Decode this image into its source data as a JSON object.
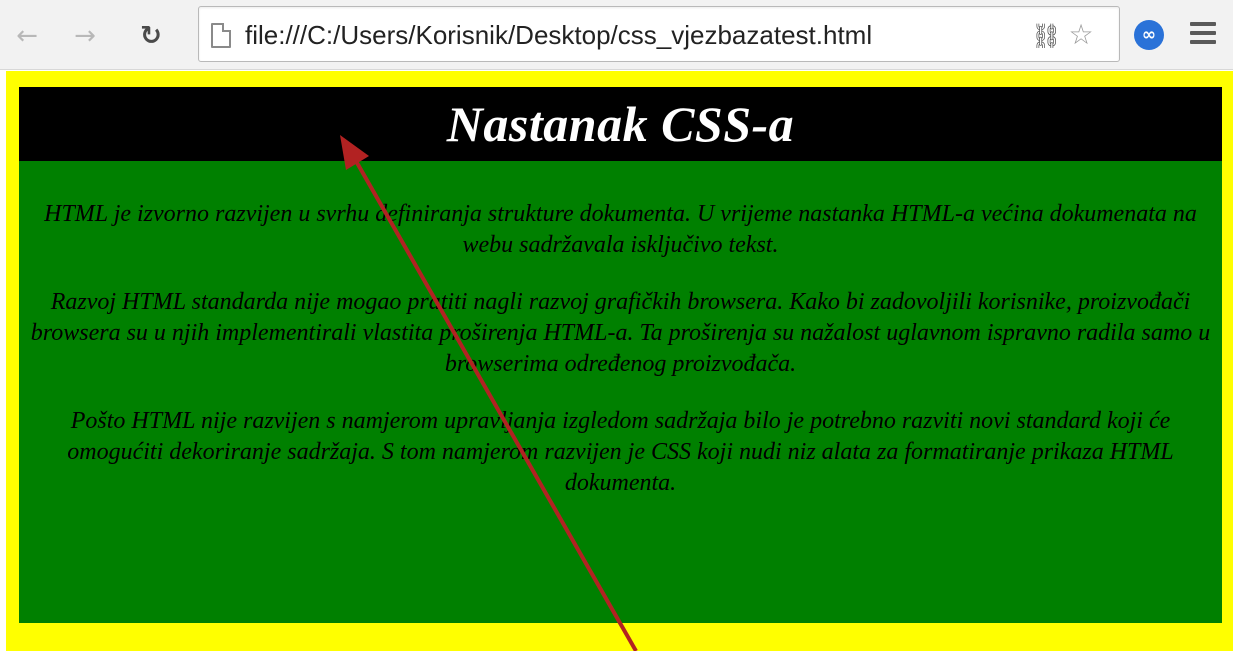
{
  "browser": {
    "nav": {
      "back_icon": "arrow-left-icon",
      "forward_icon": "arrow-right-icon",
      "reload_icon": "reload-icon"
    },
    "address_bar": {
      "url": "file:///C:/Users/Korisnik/Desktop/css_vjezbazatest.html",
      "page_icon": "document-icon"
    },
    "extension_icon": "puzzle-piece-icon",
    "bookmark_icon": "star-outline-icon",
    "sync_icon": "blue-circle-icon",
    "menu_icon": "hamburger-menu-icon"
  },
  "page": {
    "heading": "Nastanak CSS-a",
    "paragraphs": [
      "HTML je izvorno razvijen u svrhu definiranja strukture dokumenta. U vrijeme nastanka HTML-a većina dokumenata na webu sadržavala isključivo tekst.",
      "Razvoj HTML standarda nije mogao pratiti nagli razvoj grafičkih browsera. Kako bi zadovoljili korisnike, proizvođači browsera su u njih implementirali vlastita proširenja HTML-a. Ta proširenja su nažalost uglavnom ispravno radila samo u browserima određenog proizvođača.",
      "Pošto HTML nije razvijen s namjerom upravljanja izgledom sadržaja bilo je potrebno razviti novi standard koji će omogućiti dekoriranje sadržaja. S tom namjerom razvijen je CSS koji nudi niz alata za formatiranje prikaza HTML dokumenta."
    ]
  },
  "colors": {
    "page_background": "#ffff00",
    "header_background": "#000000",
    "heading_text": "#ffffff",
    "content_background": "#008000",
    "paragraph_text": "#000000",
    "annotation_arrow": "#b22222"
  }
}
